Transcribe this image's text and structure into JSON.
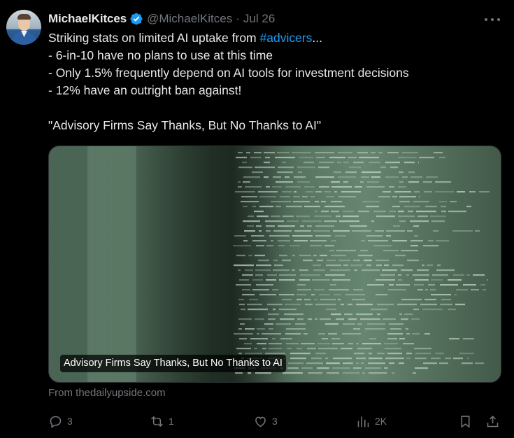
{
  "tweet": {
    "author_name": "MichaelKitces",
    "handle": "@MichaelKitces",
    "separator": "·",
    "date": "Jul 26",
    "body": {
      "line1_prefix": "Striking stats on limited AI uptake from ",
      "line1_hashtag": "#advicers",
      "line1_suffix": "...",
      "line2": "- 6-in-10 have no plans to use at this time",
      "line3": "- Only 1.5% frequently depend on AI tools for investment decisions",
      "line4": "- 12% have an outright ban against!",
      "line6": "\"Advisory Firms Say Thanks, But No Thanks to AI\""
    },
    "card": {
      "caption": "Advisory Firms Say Thanks, But No Thanks to AI",
      "source": "From thedailyupside.com"
    },
    "actions": {
      "replies": "3",
      "reposts": "1",
      "likes": "3",
      "views": "2K"
    }
  },
  "colors": {
    "background": "#000000",
    "text": "#e7e9ea",
    "muted": "#71767b",
    "link": "#1d9bf0",
    "verified": "#1d9bf0"
  },
  "icons": [
    "more-icon",
    "verified-badge-icon",
    "reply-icon",
    "repost-icon",
    "like-icon",
    "views-icon",
    "bookmark-icon",
    "share-icon"
  ]
}
